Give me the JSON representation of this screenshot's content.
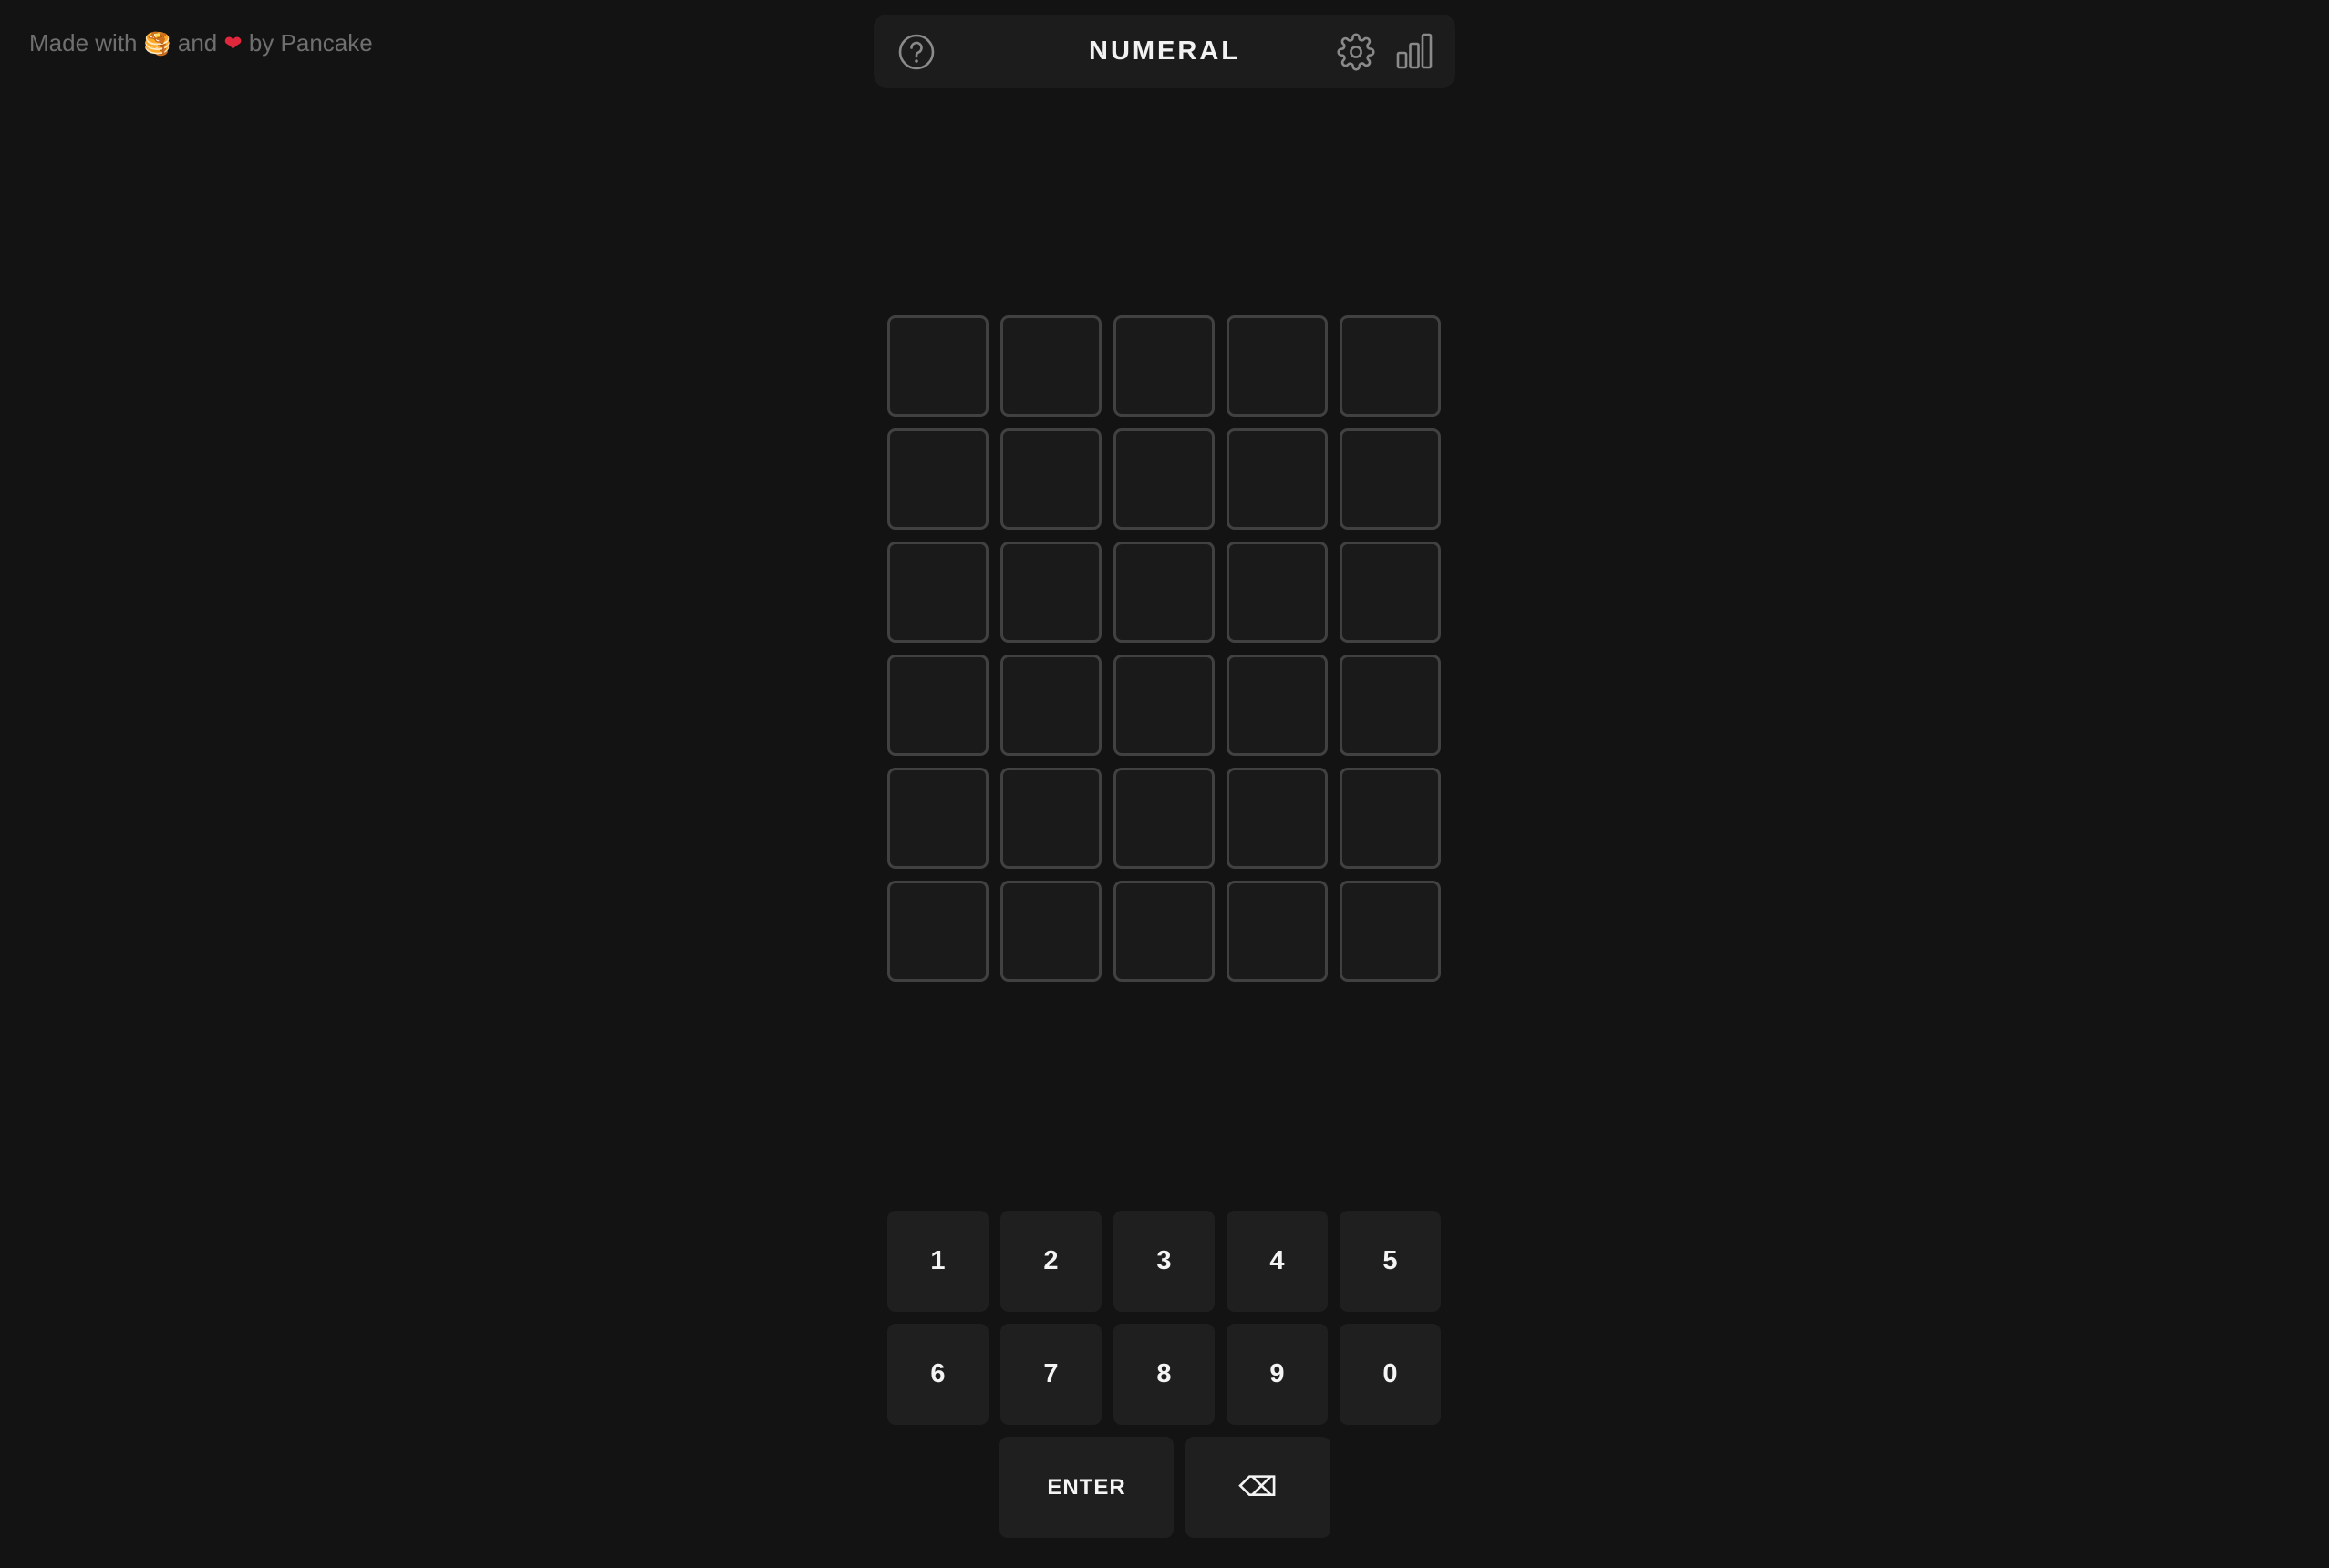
{
  "credit": {
    "prefix": "Made with",
    "pancake_emoji": "🥞",
    "middle": "and",
    "heart_emoji": "❤",
    "suffix": "by Pancake"
  },
  "header": {
    "title": "NUMERAL",
    "icons": [
      "help-icon",
      "gear-icon",
      "stats-icon"
    ]
  },
  "board": {
    "rows": [
      [
        "",
        "",
        "",
        "",
        ""
      ],
      [
        "",
        "",
        "",
        "",
        ""
      ],
      [
        "",
        "",
        "",
        "",
        ""
      ],
      [
        "",
        "",
        "",
        "",
        ""
      ],
      [
        "",
        "",
        "",
        "",
        ""
      ],
      [
        "",
        "",
        "",
        "",
        ""
      ]
    ]
  },
  "keyboard": {
    "row1": [
      "1",
      "2",
      "3",
      "4",
      "5"
    ],
    "row2": [
      "6",
      "7",
      "8",
      "9",
      "0"
    ],
    "enter_label": "ENTER",
    "backspace_label": "⌫"
  },
  "colors": {
    "background": "#131313",
    "panel": "#1c1c1c",
    "tile_border": "#414141",
    "key": "#1f1f1f",
    "text": "#f2f2f2",
    "muted_text": "#6f6f6f",
    "heart": "#e0273b"
  }
}
